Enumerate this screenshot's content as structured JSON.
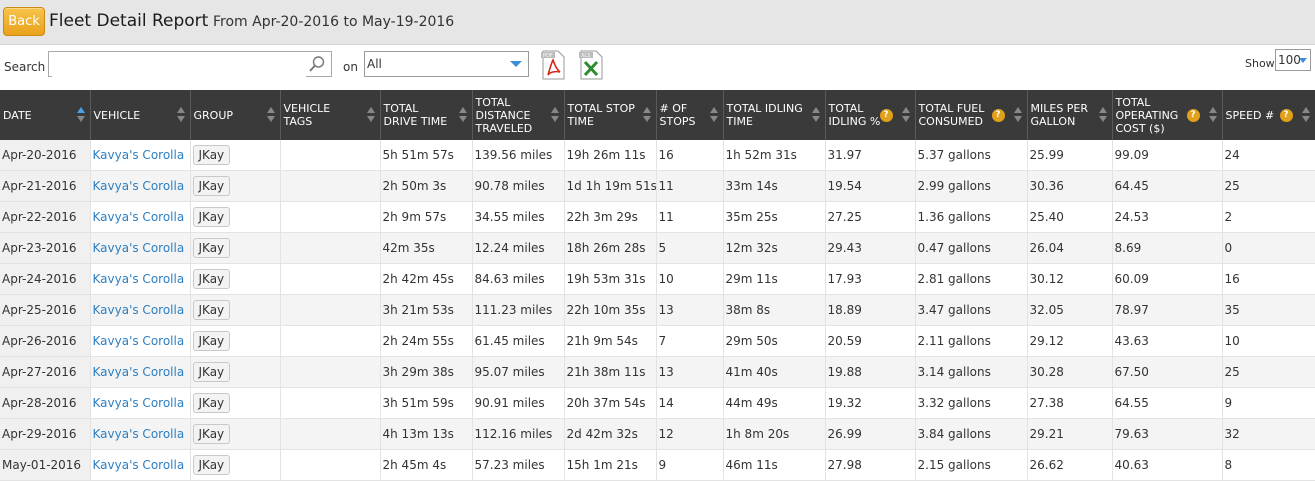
{
  "header": {
    "back_label": "Back",
    "title": "Fleet Detail Report",
    "subtitle": "From Apr-20-2016 to May-19-2016"
  },
  "toolbar": {
    "search_label": "Search :",
    "search_value": "",
    "on_label": "on",
    "filter_selected": "All",
    "pdf_icon": "pdf-export-icon",
    "xls_icon": "xls-export-icon",
    "show_label": "Show",
    "show_value": "100"
  },
  "accent_colors": {
    "back_button": "#f0b030",
    "header_bg": "#3a3a3a",
    "link": "#2d7fc2",
    "help_icon": "#e2a11a"
  },
  "table": {
    "columns": [
      {
        "label": "DATE",
        "help": false
      },
      {
        "label": "VEHICLE",
        "help": false
      },
      {
        "label": "GROUP",
        "help": false
      },
      {
        "label": "VEHICLE TAGS",
        "help": false
      },
      {
        "label": "TOTAL DRIVE TIME",
        "help": false
      },
      {
        "label": "TOTAL DISTANCE TRAVELED",
        "help": false
      },
      {
        "label": "TOTAL STOP TIME",
        "help": false
      },
      {
        "label": "# OF STOPS",
        "help": false
      },
      {
        "label": "TOTAL IDLING TIME",
        "help": false
      },
      {
        "label": "TOTAL IDLING %",
        "help": true
      },
      {
        "label": "TOTAL FUEL CONSUMED",
        "help": true
      },
      {
        "label": "MILES PER GALLON",
        "help": false
      },
      {
        "label": "TOTAL OPERATING COST ($)",
        "help": true
      },
      {
        "label": "SPEED #",
        "help": true
      }
    ],
    "rows": [
      {
        "date": "Apr-20-2016",
        "vehicle": "Kavya's Corolla",
        "group": "JKay",
        "tags": "",
        "drive": "5h 51m 57s",
        "distance": "139.56 miles",
        "stop": "19h 26m 11s",
        "stops": "16",
        "idle": "1h 52m 31s",
        "idle_pct": "31.97",
        "fuel": "5.37 gallons",
        "mpg": "25.99",
        "cost": "99.09",
        "speed": "24"
      },
      {
        "date": "Apr-21-2016",
        "vehicle": "Kavya's Corolla",
        "group": "JKay",
        "tags": "",
        "drive": "2h 50m 3s",
        "distance": "90.78 miles",
        "stop": "1d 1h 19m 51s",
        "stops": "11",
        "idle": "33m 14s",
        "idle_pct": "19.54",
        "fuel": "2.99 gallons",
        "mpg": "30.36",
        "cost": "64.45",
        "speed": "25"
      },
      {
        "date": "Apr-22-2016",
        "vehicle": "Kavya's Corolla",
        "group": "JKay",
        "tags": "",
        "drive": "2h 9m 57s",
        "distance": "34.55 miles",
        "stop": "22h 3m 29s",
        "stops": "11",
        "idle": "35m 25s",
        "idle_pct": "27.25",
        "fuel": "1.36 gallons",
        "mpg": "25.40",
        "cost": "24.53",
        "speed": "2"
      },
      {
        "date": "Apr-23-2016",
        "vehicle": "Kavya's Corolla",
        "group": "JKay",
        "tags": "",
        "drive": "42m 35s",
        "distance": "12.24 miles",
        "stop": "18h 26m 28s",
        "stops": "5",
        "idle": "12m 32s",
        "idle_pct": "29.43",
        "fuel": "0.47 gallons",
        "mpg": "26.04",
        "cost": "8.69",
        "speed": "0"
      },
      {
        "date": "Apr-24-2016",
        "vehicle": "Kavya's Corolla",
        "group": "JKay",
        "tags": "",
        "drive": "2h 42m 45s",
        "distance": "84.63 miles",
        "stop": "19h 53m 31s",
        "stops": "10",
        "idle": "29m 11s",
        "idle_pct": "17.93",
        "fuel": "2.81 gallons",
        "mpg": "30.12",
        "cost": "60.09",
        "speed": "16"
      },
      {
        "date": "Apr-25-2016",
        "vehicle": "Kavya's Corolla",
        "group": "JKay",
        "tags": "",
        "drive": "3h 21m 53s",
        "distance": "111.23 miles",
        "stop": "22h 10m 35s",
        "stops": "13",
        "idle": "38m 8s",
        "idle_pct": "18.89",
        "fuel": "3.47 gallons",
        "mpg": "32.05",
        "cost": "78.97",
        "speed": "35"
      },
      {
        "date": "Apr-26-2016",
        "vehicle": "Kavya's Corolla",
        "group": "JKay",
        "tags": "",
        "drive": "2h 24m 55s",
        "distance": "61.45 miles",
        "stop": "21h 9m 54s",
        "stops": "7",
        "idle": "29m 50s",
        "idle_pct": "20.59",
        "fuel": "2.11 gallons",
        "mpg": "29.12",
        "cost": "43.63",
        "speed": "10"
      },
      {
        "date": "Apr-27-2016",
        "vehicle": "Kavya's Corolla",
        "group": "JKay",
        "tags": "",
        "drive": "3h 29m 38s",
        "distance": "95.07 miles",
        "stop": "21h 38m 11s",
        "stops": "13",
        "idle": "41m 40s",
        "idle_pct": "19.88",
        "fuel": "3.14 gallons",
        "mpg": "30.28",
        "cost": "67.50",
        "speed": "25"
      },
      {
        "date": "Apr-28-2016",
        "vehicle": "Kavya's Corolla",
        "group": "JKay",
        "tags": "",
        "drive": "3h 51m 59s",
        "distance": "90.91 miles",
        "stop": "20h 37m 54s",
        "stops": "14",
        "idle": "44m 49s",
        "idle_pct": "19.32",
        "fuel": "3.32 gallons",
        "mpg": "27.38",
        "cost": "64.55",
        "speed": "9"
      },
      {
        "date": "Apr-29-2016",
        "vehicle": "Kavya's Corolla",
        "group": "JKay",
        "tags": "",
        "drive": "4h 13m 13s",
        "distance": "112.16 miles",
        "stop": "2d 42m 32s",
        "stops": "12",
        "idle": "1h 8m 20s",
        "idle_pct": "26.99",
        "fuel": "3.84 gallons",
        "mpg": "29.21",
        "cost": "79.63",
        "speed": "32"
      },
      {
        "date": "May-01-2016",
        "vehicle": "Kavya's Corolla",
        "group": "JKay",
        "tags": "",
        "drive": "2h 45m 4s",
        "distance": "57.23 miles",
        "stop": "15h 1m 21s",
        "stops": "9",
        "idle": "46m 11s",
        "idle_pct": "27.98",
        "fuel": "2.15 gallons",
        "mpg": "26.62",
        "cost": "40.63",
        "speed": "8"
      }
    ]
  }
}
